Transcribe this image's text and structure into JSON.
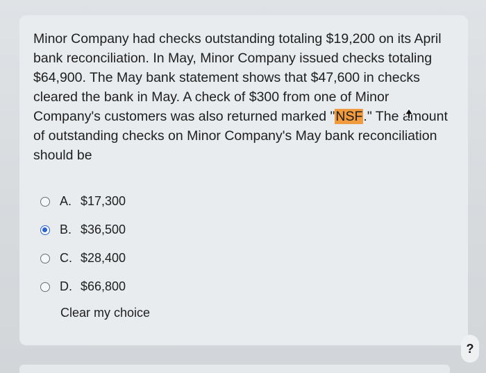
{
  "question": {
    "text_before": "Minor Company had checks outstanding totaling $19,200 on its April bank reconciliation. In May, Minor Company issued checks totaling $64,900. The May bank statement shows that $47,600 in checks cleared the bank in May. A check of $300 from one of Minor Company's customers was also returned marked \"",
    "highlight": "NSF",
    "text_mid": ".\" The a",
    "text_after": "mount of outstanding checks on Minor Company's May bank reconciliation should be"
  },
  "options": [
    {
      "letter": "A.",
      "value": "$17,300",
      "selected": false
    },
    {
      "letter": "B.",
      "value": "$36,500",
      "selected": true
    },
    {
      "letter": "C.",
      "value": "$28,400",
      "selected": false
    },
    {
      "letter": "D.",
      "value": "$66,800",
      "selected": false
    }
  ],
  "clear_choice": "Clear my choice",
  "help": {
    "label": "?"
  },
  "colors": {
    "highlight": "#f19a3e",
    "radio_selected": "#2a62d8",
    "card_background": "#e9ecee"
  }
}
